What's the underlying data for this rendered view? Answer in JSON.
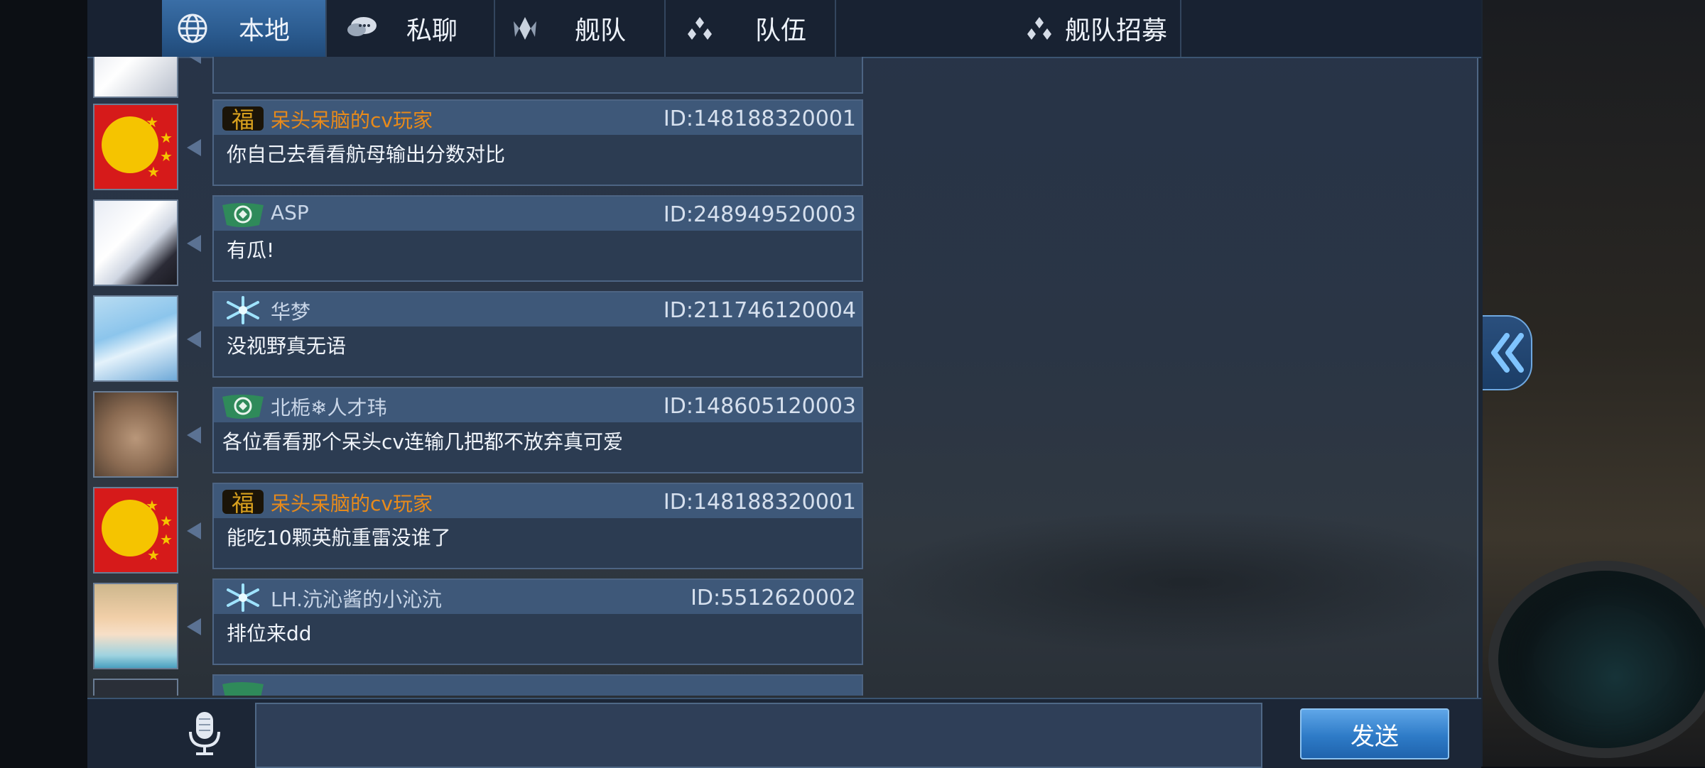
{
  "tabs": [
    {
      "label": "本地",
      "icon": "globe-icon",
      "active": true
    },
    {
      "label": "私聊",
      "icon": "chat-bubble-icon",
      "active": false
    },
    {
      "label": "舰队",
      "icon": "fleet-emblem-icon",
      "active": false
    },
    {
      "label": "队伍",
      "icon": "team-dots-icon",
      "active": false
    },
    {
      "label": "舰队招募",
      "icon": "team-dots-icon",
      "active": false
    }
  ],
  "messages": [
    {
      "name": "呆头呆脑的cv玩家",
      "id": "ID:148188320001",
      "text": "你自己去看看航母输出分数对比",
      "badge": "fu-badge",
      "gold": true
    },
    {
      "name": "ASP",
      "id": "ID:248949520003",
      "text": "有瓜!",
      "badge": "green-wing-badge",
      "gold": false
    },
    {
      "name": "华梦",
      "id": "ID:211746120004",
      "text": "没视野真无语",
      "badge": "blue-snowflake-badge",
      "gold": false
    },
    {
      "name": "北栀❄人才玮",
      "id": "ID:148605120003",
      "text": "各位看看那个呆头cv连输几把都不放弃真可爱",
      "badge": "green-wing-badge",
      "gold": false
    },
    {
      "name": "呆头呆脑的cv玩家",
      "id": "ID:148188320001",
      "text": "能吃10颗英航重雷没谁了",
      "badge": "fu-badge",
      "gold": true
    },
    {
      "name": "LH.沆沁酱的小沁沆",
      "id": "ID:5512620002",
      "text": "排位来dd",
      "badge": "blue-snowflake-badge",
      "gold": false
    }
  ],
  "partial_top_text": "",
  "bottom": {
    "input_value": "",
    "send_label": "发送"
  },
  "colors": {
    "gold_name": "#e88a1a",
    "active_tab": "#2a5a8e",
    "send_button": "#2e7bc7"
  }
}
